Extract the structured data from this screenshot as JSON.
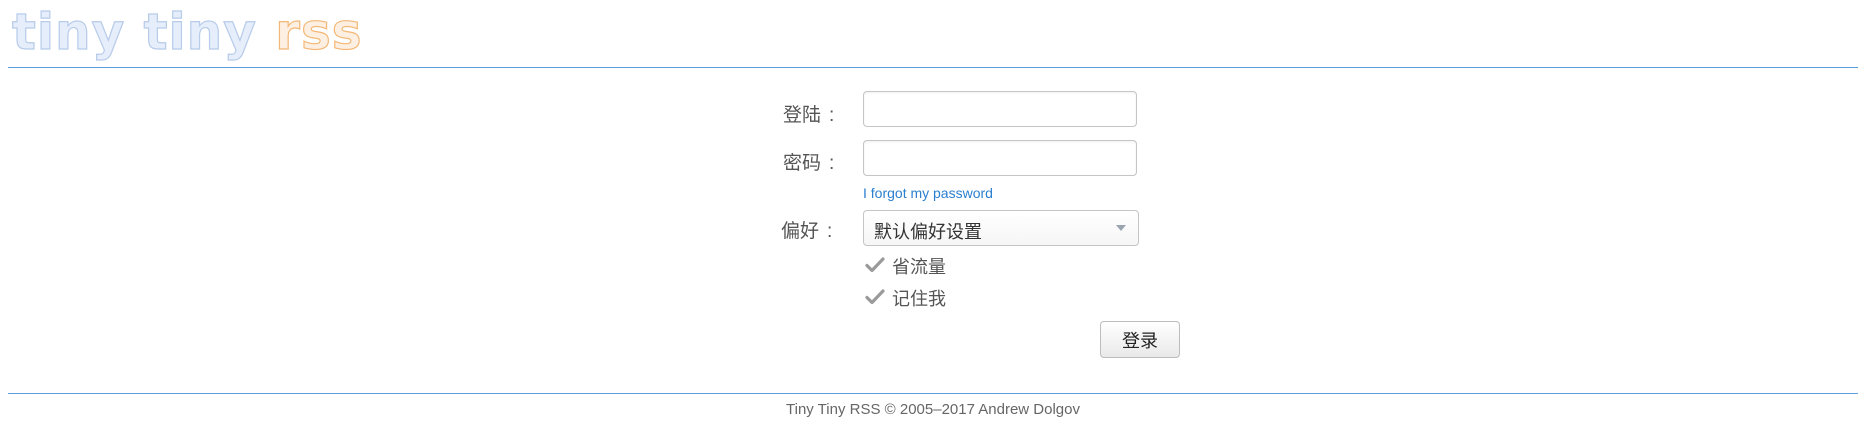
{
  "logo": {
    "part_a": "tiny tiny ",
    "part_b": "rss"
  },
  "form": {
    "login_label": "登陆",
    "password_label": "密码",
    "profile_label": "偏好",
    "colon": ":",
    "login_value": "",
    "password_value": "",
    "forgot_password_link": "I forgot my password",
    "profile_selected": "默认偏好设置",
    "checkboxes": [
      {
        "label": "省流量",
        "checked": true
      },
      {
        "label": "记住我",
        "checked": true
      }
    ],
    "submit_label": "登录"
  },
  "footer": {
    "text": "Tiny Tiny RSS © 2005–2017 Andrew Dolgov"
  },
  "colors": {
    "logo_blue": "#b7cbea",
    "logo_orange": "#f3b877",
    "divider": "#5aa0e0",
    "link": "#2a7fcf",
    "check": "#9a9a9a"
  },
  "icons": {
    "checkbox": "check-mark-icon",
    "select": "chevron-down-icon"
  }
}
